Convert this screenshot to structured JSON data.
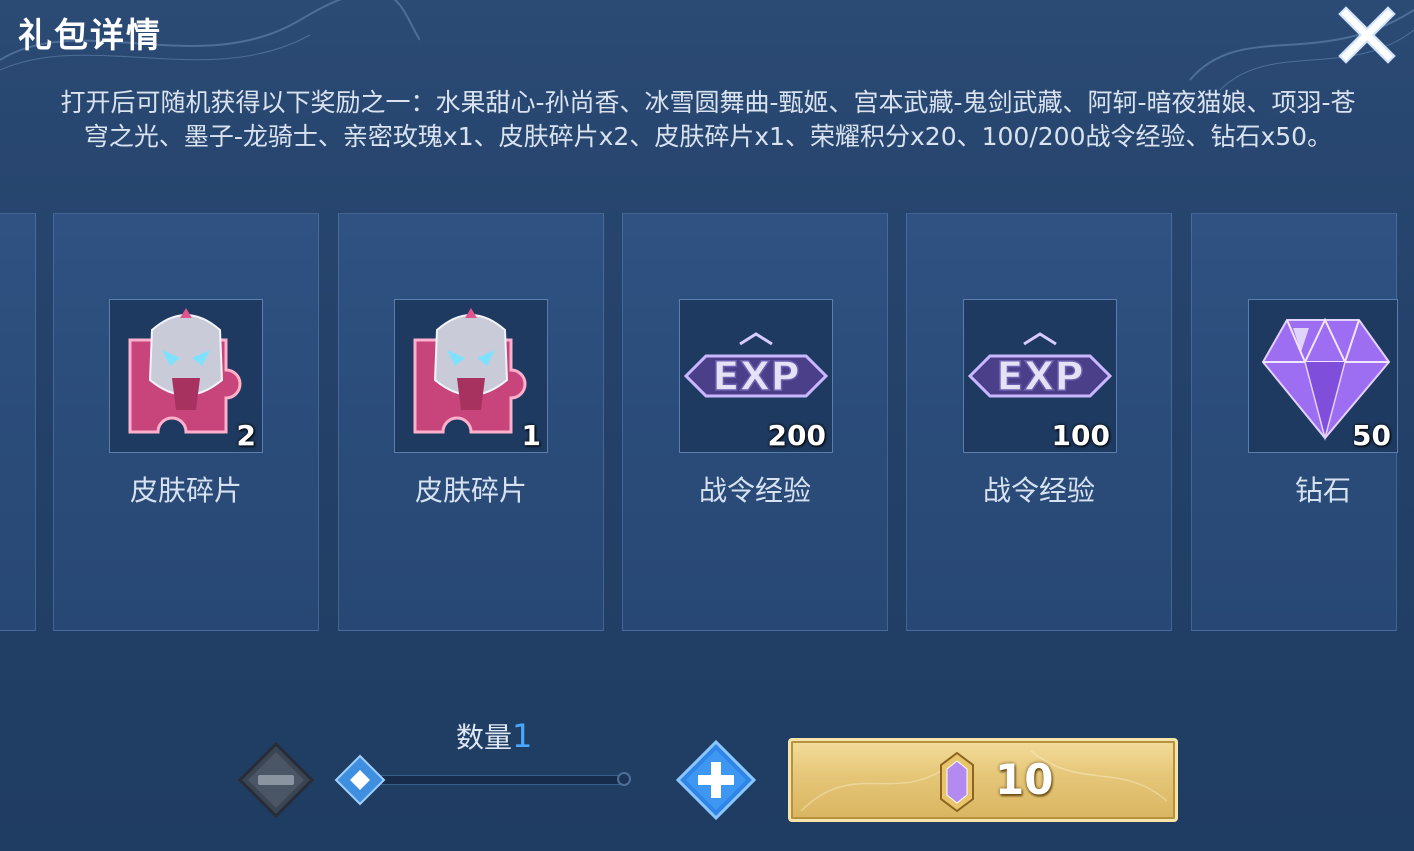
{
  "header": {
    "title": "礼包详情"
  },
  "description": "打开后可随机获得以下奖励之一：水果甜心-孙尚香、冰雪圆舞曲-甄姬、宫本武藏-鬼剑武藏、阿轲-暗夜猫娘、项羽-苍穹之光、墨子-龙骑士、亲密玫瑰x1、皮肤碎片x2、皮肤碎片x1、荣耀积分x20、100/200战令经验、钻石x50。",
  "rewards": [
    {
      "label": "皮肤碎片",
      "quantity": "2",
      "icon": "skin-fragment-icon"
    },
    {
      "label": "皮肤碎片",
      "quantity": "1",
      "icon": "skin-fragment-icon"
    },
    {
      "label": "战令经验",
      "quantity": "200",
      "icon": "exp-icon"
    },
    {
      "label": "战令经验",
      "quantity": "100",
      "icon": "exp-icon"
    },
    {
      "label": "钻石",
      "quantity": "50",
      "icon": "diamond-icon"
    }
  ],
  "quantity_selector": {
    "label": "数量",
    "value": "1"
  },
  "purchase": {
    "price": "10",
    "currency_icon": "gem-coin-icon"
  },
  "colors": {
    "accent_blue": "#4aa7ff",
    "button_gold": "#e5c678",
    "background": "#24426a"
  }
}
